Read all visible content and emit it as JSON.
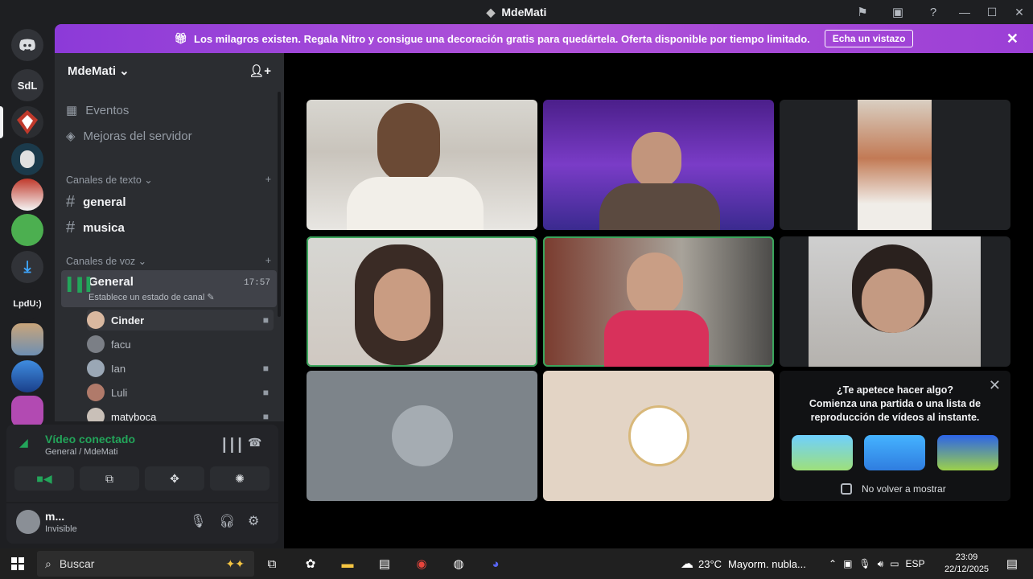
{
  "window": {
    "title": "MdeMati"
  },
  "banner": {
    "text": "Los milagros existen. Regala Nitro y consigue una decoración gratis para quedártela. Oferta disponible por tiempo limitado.",
    "cta": "Echa un vistazo"
  },
  "guilds": [
    "SdL",
    "LpdU:)"
  ],
  "server": {
    "name": "MdeMati",
    "nav": [
      "Eventos",
      "Mejoras del servidor"
    ],
    "text_category": "Canales de texto",
    "text_channels": [
      "general",
      "musica"
    ],
    "voice_category": "Canales de voz",
    "voice_channel": {
      "name": "General",
      "status": "Establece un estado de canal",
      "time": "17:57"
    },
    "members": [
      "Cinder",
      "facu",
      "Ian",
      "Luli",
      "matyboca"
    ]
  },
  "rtc": {
    "status": "Vídeo conectado",
    "location": "General / MdeMati"
  },
  "user": {
    "name": "m...",
    "status": "Invisible"
  },
  "activity": {
    "title": "¿Te apetece hacer algo?",
    "body": "Comienza una partida o una lista de reproducción de vídeos al instante.",
    "dont_show": "No volver a mostrar"
  },
  "taskbar": {
    "search": "Buscar",
    "weather": "23°C",
    "forecast": "Mayorm. nubla...",
    "lang": "ESP",
    "time": "23:09",
    "date": "22/12/2025"
  },
  "colors": {
    "accent_green": "#23a55a",
    "speaking_outline": "#3ba55c",
    "banner": "#a048d8"
  }
}
